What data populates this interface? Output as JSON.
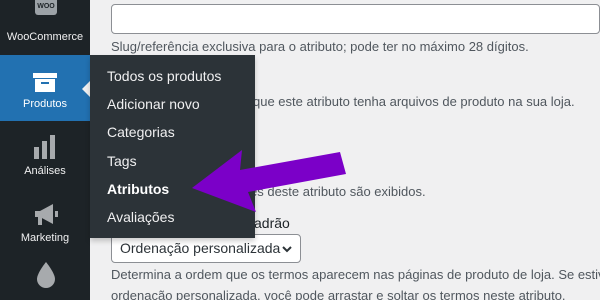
{
  "sidebar": {
    "woo_logo": "WOO",
    "woocommerce_label": "WooCommerce",
    "produtos_label": "Produtos",
    "analises_label": "Análises",
    "marketing_label": "Marketing"
  },
  "flyout": {
    "items": [
      "Todos os produtos",
      "Adicionar novo",
      "Categorias",
      "Tags",
      "Atributos",
      "Avaliações"
    ],
    "active_index": 4
  },
  "main": {
    "slug_input_value": "",
    "slug_help": "Slug/referência exclusiva para o atributo; pode ter no máximo 28 dígitos.",
    "archives_help_partial": "que este atributo tenha arquivos de produto na sua loja.",
    "terms_help_partial": "es deste atributo são exibidos.",
    "default_sort_label_partial": "adrão",
    "sort_select_value": "Ordenação personalizada",
    "sort_help_line1": "Determina a ordem que os termos aparecem nas páginas de produto de loja. Se estive",
    "sort_help_line2": "ordenação personalizada, você pode arrastar e soltar os termos neste atributo."
  },
  "colors": {
    "sidebar_bg": "#1d2327",
    "active_bg": "#2271b1",
    "flyout_bg": "#2c3338",
    "arrow": "#7b00c8"
  }
}
